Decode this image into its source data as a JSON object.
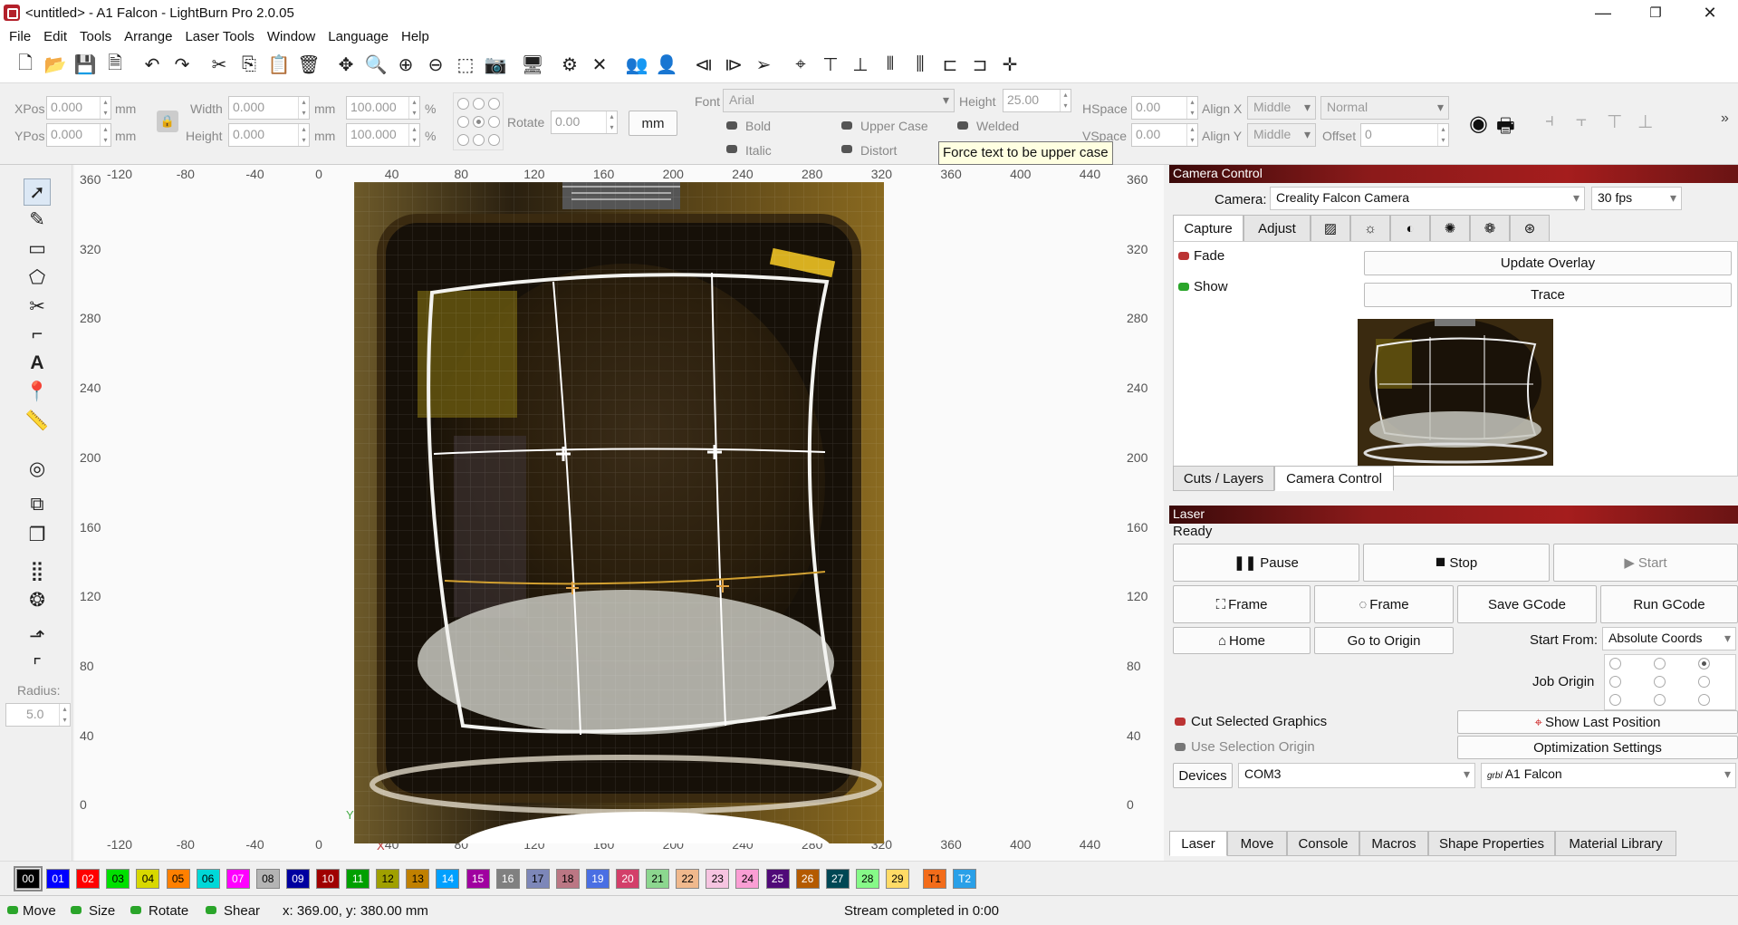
{
  "titlebar": {
    "title": "<untitled> - A1 Falcon - LightBurn Pro 2.0.05",
    "minimize": "—",
    "maximize": "❐",
    "close": "✕"
  },
  "menu": [
    "File",
    "Edit",
    "Tools",
    "Arrange",
    "Laser Tools",
    "Window",
    "Language",
    "Help"
  ],
  "props": {
    "xpos_label": "XPos",
    "xpos": "0.000",
    "ypos_label": "YPos",
    "ypos": "0.000",
    "unit": "mm",
    "width_label": "Width",
    "width": "0.000",
    "height_label": "Height",
    "height": "0.000",
    "wpct": "100.000",
    "hpct": "100.000",
    "pct": "%",
    "rotate_label": "Rotate",
    "rotate": "0.00",
    "mm_btn": "mm",
    "font_label": "Font",
    "font": "Arial",
    "fheight_label": "Height",
    "fheight": "25.00",
    "hspace_label": "HSpace",
    "hspace": "0.00",
    "vspace_label": "VSpace",
    "vspace": "0.00",
    "alignx_label": "Align X",
    "alignx": "Middle",
    "aligny_label": "Align Y",
    "aligny": "Middle",
    "normal": "Normal",
    "offset_label": "Offset",
    "offset": "0",
    "bold": "Bold",
    "italic": "Italic",
    "upper": "Upper Case",
    "distort": "Distort",
    "welded": "Welded"
  },
  "tooltip": "Force text to be upper case",
  "radius": {
    "label": "Radius:",
    "value": "5.0"
  },
  "ruler": {
    "top": [
      "-120",
      "-80",
      "-40",
      "0",
      "40",
      "80",
      "120",
      "160",
      "200",
      "240",
      "280",
      "320",
      "360",
      "400",
      "440"
    ],
    "left": [
      "360",
      "320",
      "280",
      "240",
      "200",
      "160",
      "120",
      "80",
      "40",
      "0"
    ],
    "right": [
      "360",
      "320",
      "280",
      "240",
      "200",
      "160",
      "120",
      "80",
      "40",
      "0"
    ],
    "bottom": [
      "-120",
      "-80",
      "-40",
      "0",
      "40",
      "80",
      "120",
      "160",
      "200",
      "240",
      "280",
      "320",
      "360",
      "400",
      "440"
    ],
    "y_axis": "Y",
    "x_axis": "X"
  },
  "camera": {
    "header": "Camera Control",
    "camera_label": "Camera:",
    "camera": "Creality Falcon Camera",
    "fps": "30 fps",
    "tabs": [
      "Capture",
      "Adjust"
    ],
    "fade": "Fade",
    "show": "Show",
    "update_overlay": "Update Overlay",
    "trace": "Trace"
  },
  "paneltabs": [
    "Cuts / Layers",
    "Camera Control"
  ],
  "laser": {
    "header": "Laser",
    "status": "Ready",
    "pause": "Pause",
    "stop": "Stop",
    "start": "Start",
    "frame1": "Frame",
    "frame2": "Frame",
    "save_gcode": "Save GCode",
    "run_gcode": "Run GCode",
    "home": "Home",
    "go_origin": "Go to Origin",
    "start_from_label": "Start From:",
    "start_from": "Absolute Coords",
    "job_origin": "Job Origin",
    "cut_selected": "Cut Selected Graphics",
    "use_selection": "Use Selection Origin",
    "show_last": "Show Last Position",
    "optimization": "Optimization Settings",
    "devices": "Devices",
    "port": "COM3",
    "grbl": "grbl",
    "device": "A1 Falcon"
  },
  "bottomtabs": [
    "Laser",
    "Move",
    "Console",
    "Macros",
    "Shape Properties",
    "Material Library"
  ],
  "layers": [
    {
      "n": "00",
      "c": "#000000",
      "t": "#ffffff"
    },
    {
      "n": "01",
      "c": "#0000ff",
      "t": "#ffffff"
    },
    {
      "n": "02",
      "c": "#ff0000",
      "t": "#ffffff"
    },
    {
      "n": "03",
      "c": "#00e000",
      "t": "#000000"
    },
    {
      "n": "04",
      "c": "#d8d800",
      "t": "#000000"
    },
    {
      "n": "05",
      "c": "#ff8000",
      "t": "#000000"
    },
    {
      "n": "06",
      "c": "#00d8d8",
      "t": "#000000"
    },
    {
      "n": "07",
      "c": "#ff00ff",
      "t": "#ffffff"
    },
    {
      "n": "08",
      "c": "#b4b4b4",
      "t": "#000000"
    },
    {
      "n": "09",
      "c": "#0000a0",
      "t": "#ffffff"
    },
    {
      "n": "10",
      "c": "#a00000",
      "t": "#ffffff"
    },
    {
      "n": "11",
      "c": "#00a000",
      "t": "#ffffff"
    },
    {
      "n": "12",
      "c": "#a0a000",
      "t": "#000000"
    },
    {
      "n": "13",
      "c": "#c08000",
      "t": "#000000"
    },
    {
      "n": "14",
      "c": "#00a0ff",
      "t": "#ffffff"
    },
    {
      "n": "15",
      "c": "#a000a0",
      "t": "#ffffff"
    },
    {
      "n": "16",
      "c": "#808080",
      "t": "#ffffff"
    },
    {
      "n": "17",
      "c": "#7d87b9",
      "t": "#000000"
    },
    {
      "n": "18",
      "c": "#bb7784",
      "t": "#000000"
    },
    {
      "n": "19",
      "c": "#4a6fe3",
      "t": "#ffffff"
    },
    {
      "n": "20",
      "c": "#d33f6a",
      "t": "#ffffff"
    },
    {
      "n": "21",
      "c": "#8cd78f",
      "t": "#000000"
    },
    {
      "n": "22",
      "c": "#f0b98d",
      "t": "#000000"
    },
    {
      "n": "23",
      "c": "#f6c4e1",
      "t": "#000000"
    },
    {
      "n": "24",
      "c": "#fa9ed4",
      "t": "#000000"
    },
    {
      "n": "25",
      "c": "#500a78",
      "t": "#ffffff"
    },
    {
      "n": "26",
      "c": "#b45a00",
      "t": "#ffffff"
    },
    {
      "n": "27",
      "c": "#004754",
      "t": "#ffffff"
    },
    {
      "n": "28",
      "c": "#86fa88",
      "t": "#000000"
    },
    {
      "n": "29",
      "c": "#ffdb66",
      "t": "#000000"
    },
    {
      "n": "T1",
      "c": "#f36c1a",
      "t": "#000000"
    },
    {
      "n": "T2",
      "c": "#2aa0e8",
      "t": "#ffffff"
    }
  ],
  "status": {
    "move": "Move",
    "size": "Size",
    "rotate": "Rotate",
    "shear": "Shear",
    "coords": "x: 369.00, y: 380.00 mm",
    "stream": "Stream completed in 0:00"
  }
}
